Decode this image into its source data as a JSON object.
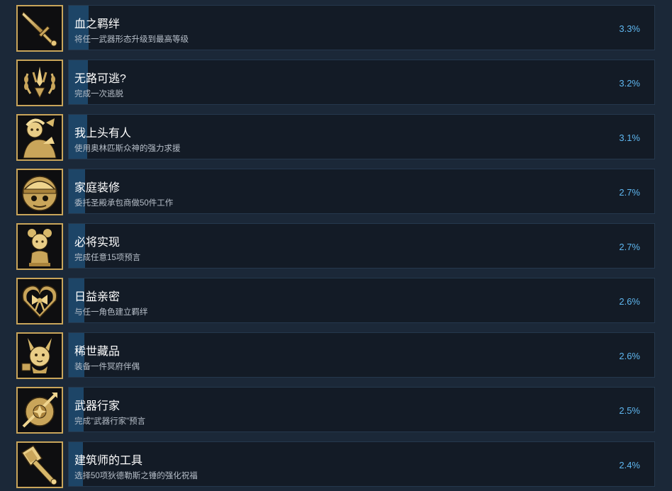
{
  "colors": {
    "background": "#1b2838",
    "card_background": "#131b26",
    "card_border": "#25384d",
    "progress_fill": "#1d4567",
    "percent_text": "#5fb7f0",
    "icon_gold": "#c9a55a"
  },
  "achievements": [
    {
      "title": "血之羁绊",
      "description": "将任一武器形态升级到最高等级",
      "percent": "3.3%",
      "progress": 0.033,
      "icon": "sword-icon"
    },
    {
      "title": "无路可逃?",
      "description": "完成一次逃脱",
      "percent": "3.2%",
      "progress": 0.032,
      "icon": "laurel-emblem-icon"
    },
    {
      "title": "我上头有人",
      "description": "使用奥林匹斯众神的强力求援",
      "percent": "3.1%",
      "progress": 0.031,
      "icon": "gods-portrait-icon"
    },
    {
      "title": "家庭装修",
      "description": "委托圣殿承包商做50件工作",
      "percent": "2.7%",
      "progress": 0.027,
      "icon": "contractor-helmet-icon"
    },
    {
      "title": "必将实现",
      "description": "完成任意15项预言",
      "percent": "2.7%",
      "progress": 0.027,
      "icon": "fates-bust-icon"
    },
    {
      "title": "日益亲密",
      "description": "与任一角色建立羁绊",
      "percent": "2.6%",
      "progress": 0.026,
      "icon": "heart-bow-icon"
    },
    {
      "title": "稀世藏品",
      "description": "装备一件冥府伴偶",
      "percent": "2.6%",
      "progress": 0.026,
      "icon": "companion-plush-icon"
    },
    {
      "title": "武器行家",
      "description": "完成\"武器行家\"预言",
      "percent": "2.5%",
      "progress": 0.025,
      "icon": "weapon-aspects-icon"
    },
    {
      "title": "建筑师的工具",
      "description": "选择50项狄德勒斯之锤的强化祝福",
      "percent": "2.4%",
      "progress": 0.024,
      "icon": "hammer-icon"
    }
  ]
}
